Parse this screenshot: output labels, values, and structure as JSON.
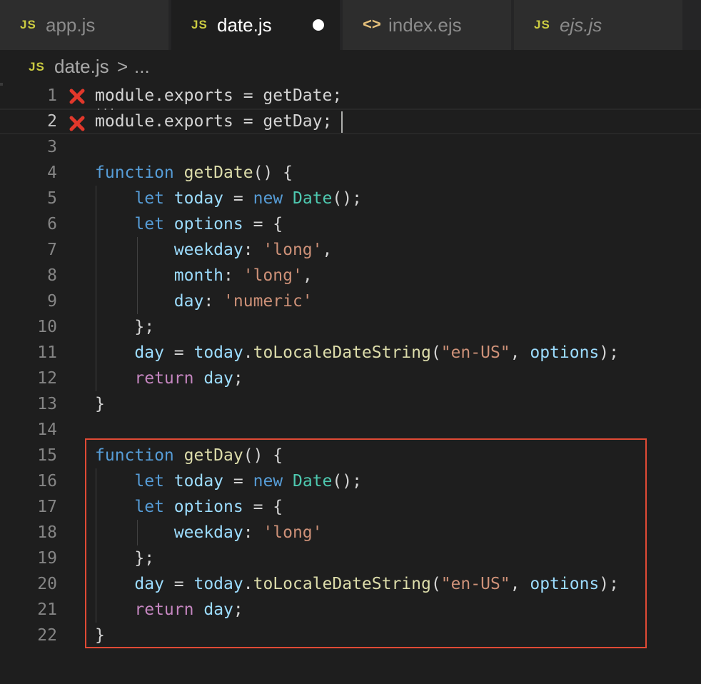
{
  "tabs": [
    {
      "icon": "JS",
      "label": "app.js",
      "active": false,
      "dirty": false,
      "italic": false
    },
    {
      "icon": "JS",
      "label": "date.js",
      "active": true,
      "dirty": true,
      "italic": false
    },
    {
      "icon": "<>",
      "label": "index.ejs",
      "active": false,
      "dirty": false,
      "italic": false
    },
    {
      "icon": "JS",
      "label": "ejs.js",
      "active": false,
      "dirty": false,
      "italic": true
    }
  ],
  "breadcrumb": {
    "icon": "JS",
    "file": "date.js",
    "separator": ">",
    "more": "..."
  },
  "editor": {
    "current_line": 2,
    "error_lines": [
      1,
      2
    ],
    "lines": [
      {
        "num": "1",
        "tokens": [
          [
            "p",
            "module.exports = getDate;"
          ]
        ]
      },
      {
        "num": "2",
        "tokens": [
          [
            "p",
            "module.exports = getDay;"
          ]
        ]
      },
      {
        "num": "3",
        "tokens": []
      },
      {
        "num": "4",
        "tokens": [
          [
            "kw",
            "function"
          ],
          [
            "p",
            " "
          ],
          [
            "fn",
            "getDate"
          ],
          [
            "p",
            "() {"
          ]
        ]
      },
      {
        "num": "5",
        "tokens": [
          [
            "p",
            "    "
          ],
          [
            "kw",
            "let"
          ],
          [
            "p",
            " "
          ],
          [
            "var",
            "today"
          ],
          [
            "p",
            " = "
          ],
          [
            "kw",
            "new"
          ],
          [
            "p",
            " "
          ],
          [
            "cls",
            "Date"
          ],
          [
            "p",
            "();"
          ]
        ]
      },
      {
        "num": "6",
        "tokens": [
          [
            "p",
            "    "
          ],
          [
            "kw",
            "let"
          ],
          [
            "p",
            " "
          ],
          [
            "var",
            "options"
          ],
          [
            "p",
            " = {"
          ]
        ]
      },
      {
        "num": "7",
        "tokens": [
          [
            "p",
            "        "
          ],
          [
            "var",
            "weekday"
          ],
          [
            "p",
            ": "
          ],
          [
            "str",
            "'long'"
          ],
          [
            "p",
            ","
          ]
        ]
      },
      {
        "num": "8",
        "tokens": [
          [
            "p",
            "        "
          ],
          [
            "var",
            "month"
          ],
          [
            "p",
            ": "
          ],
          [
            "str",
            "'long'"
          ],
          [
            "p",
            ","
          ]
        ]
      },
      {
        "num": "9",
        "tokens": [
          [
            "p",
            "        "
          ],
          [
            "var",
            "day"
          ],
          [
            "p",
            ": "
          ],
          [
            "str",
            "'numeric'"
          ]
        ]
      },
      {
        "num": "10",
        "tokens": [
          [
            "p",
            "    };"
          ]
        ]
      },
      {
        "num": "11",
        "tokens": [
          [
            "p",
            "    "
          ],
          [
            "var",
            "day"
          ],
          [
            "p",
            " = "
          ],
          [
            "var",
            "today"
          ],
          [
            "p",
            "."
          ],
          [
            "fn",
            "toLocaleDateString"
          ],
          [
            "p",
            "("
          ],
          [
            "str",
            "\"en-US\""
          ],
          [
            "p",
            ", "
          ],
          [
            "var",
            "options"
          ],
          [
            "p",
            ");"
          ]
        ]
      },
      {
        "num": "12",
        "tokens": [
          [
            "p",
            "    "
          ],
          [
            "ret",
            "return"
          ],
          [
            "p",
            " "
          ],
          [
            "var",
            "day"
          ],
          [
            "p",
            ";"
          ]
        ]
      },
      {
        "num": "13",
        "tokens": [
          [
            "p",
            "}"
          ]
        ]
      },
      {
        "num": "14",
        "tokens": []
      },
      {
        "num": "15",
        "tokens": [
          [
            "kw",
            "function"
          ],
          [
            "p",
            " "
          ],
          [
            "fn",
            "getDay"
          ],
          [
            "p",
            "() {"
          ]
        ]
      },
      {
        "num": "16",
        "tokens": [
          [
            "p",
            "    "
          ],
          [
            "kw",
            "let"
          ],
          [
            "p",
            " "
          ],
          [
            "var",
            "today"
          ],
          [
            "p",
            " = "
          ],
          [
            "kw",
            "new"
          ],
          [
            "p",
            " "
          ],
          [
            "cls",
            "Date"
          ],
          [
            "p",
            "();"
          ]
        ]
      },
      {
        "num": "17",
        "tokens": [
          [
            "p",
            "    "
          ],
          [
            "kw",
            "let"
          ],
          [
            "p",
            " "
          ],
          [
            "var",
            "options"
          ],
          [
            "p",
            " = {"
          ]
        ]
      },
      {
        "num": "18",
        "tokens": [
          [
            "p",
            "        "
          ],
          [
            "var",
            "weekday"
          ],
          [
            "p",
            ": "
          ],
          [
            "str",
            "'long'"
          ]
        ]
      },
      {
        "num": "19",
        "tokens": [
          [
            "p",
            "    };"
          ]
        ]
      },
      {
        "num": "20",
        "tokens": [
          [
            "p",
            "    "
          ],
          [
            "var",
            "day"
          ],
          [
            "p",
            " = "
          ],
          [
            "var",
            "today"
          ],
          [
            "p",
            "."
          ],
          [
            "fn",
            "toLocaleDateString"
          ],
          [
            "p",
            "("
          ],
          [
            "str",
            "\"en-US\""
          ],
          [
            "p",
            ", "
          ],
          [
            "var",
            "options"
          ],
          [
            "p",
            ");"
          ]
        ]
      },
      {
        "num": "21",
        "tokens": [
          [
            "p",
            "    "
          ],
          [
            "ret",
            "return"
          ],
          [
            "p",
            " "
          ],
          [
            "var",
            "day"
          ],
          [
            "p",
            ";"
          ]
        ]
      },
      {
        "num": "22",
        "tokens": [
          [
            "p",
            "}"
          ]
        ]
      }
    ]
  },
  "colors": {
    "error": "#e2382b",
    "highlight_border": "#e04a35"
  }
}
